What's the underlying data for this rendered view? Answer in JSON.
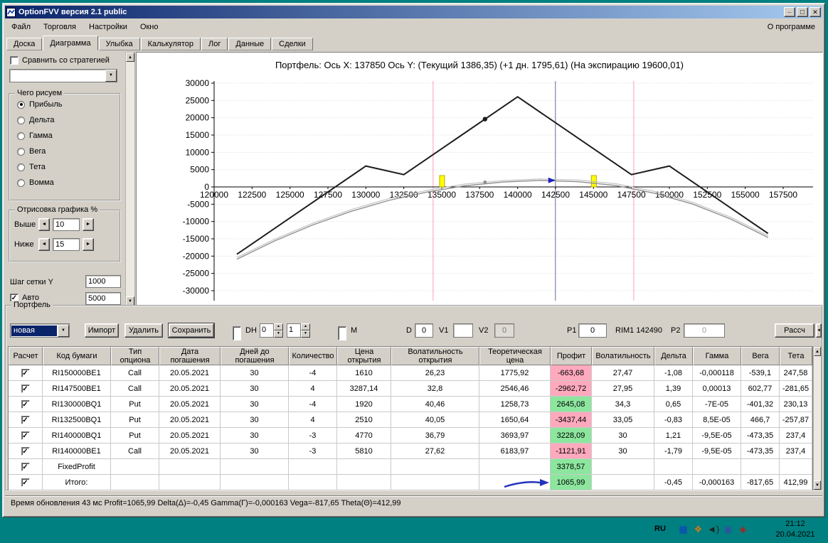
{
  "colors": {
    "desktop": "#008080",
    "window_face": "#d4d0c8",
    "titlebar_left": "#0a246a",
    "titlebar_right": "#a6caf0",
    "profit_positive_bg": "#8ce69e",
    "profit_negative_bg": "#ffa9bd",
    "selection_bg": "#0a246a"
  },
  "window": {
    "title": "OptionFVV версия 2.1 public",
    "menu": [
      "Файл",
      "Торговля",
      "Настройки",
      "Окно"
    ],
    "menu_right": "О программе",
    "tabs": [
      "Доска",
      "Диаграмма",
      "Улыбка",
      "Калькулятор",
      "Лог",
      "Данные",
      "Сделки"
    ],
    "active_tab": "Диаграмма"
  },
  "left_panel": {
    "compare_label": "Сравнить со стратегией",
    "compare_checked": false,
    "strategy_dropdown_value": "",
    "draw_group": {
      "title": "Чего рисуем",
      "options": [
        "Прибыль",
        "Дельта",
        "Гамма",
        "Вега",
        "Тета",
        "Вомма"
      ],
      "selected": "Прибыль"
    },
    "range_group": {
      "title": "Отрисовка графика %",
      "above_label": "Выше",
      "above_value": "10",
      "below_label": "Ниже",
      "below_value": "15"
    },
    "grid_step_label": "Шаг сетки Y",
    "grid_step_value": "1000",
    "auto_label": "Авто",
    "auto_checked": true,
    "auto_value": "5000"
  },
  "chart_data": {
    "type": "line",
    "title": "Портфель: Ось X: 137850 Ось Y:  (Текущий 1386,35)  (+1 дн. 1795,61)  (На экспирацию 19600,01)",
    "xlim": [
      120000,
      157500
    ],
    "ylim": [
      -30000,
      30000
    ],
    "x_ticks": [
      120000,
      122500,
      125000,
      127500,
      130000,
      132500,
      135000,
      137500,
      140000,
      142500,
      145000,
      147500,
      150000,
      152500,
      155000,
      157500
    ],
    "y_ticks": [
      30000,
      25000,
      20000,
      15000,
      10000,
      5000,
      0,
      -5000,
      -10000,
      -15000,
      -20000,
      -25000,
      -30000
    ],
    "grid": true,
    "legend": "none",
    "series": [
      {
        "name": "expiration-payoff",
        "color": "#1c1c1c",
        "width": 2,
        "points": [
          [
            121500,
            -19450
          ],
          [
            130000,
            6050
          ],
          [
            132500,
            3550
          ],
          [
            140000,
            26050
          ],
          [
            147500,
            3550
          ],
          [
            150000,
            6050
          ],
          [
            156500,
            -13450
          ]
        ]
      },
      {
        "name": "current-profit",
        "color": "#8f8f8f",
        "width": 1.4,
        "points": [
          [
            121500,
            -20900
          ],
          [
            124000,
            -15600
          ],
          [
            126500,
            -11000
          ],
          [
            129000,
            -7100
          ],
          [
            131500,
            -3900
          ],
          [
            134000,
            -1500
          ],
          [
            136500,
            300
          ],
          [
            139000,
            1400
          ],
          [
            141500,
            1900
          ],
          [
            144000,
            1500
          ],
          [
            146500,
            400
          ],
          [
            149000,
            -1800
          ],
          [
            151500,
            -4900
          ],
          [
            154000,
            -9200
          ],
          [
            156500,
            -14600
          ]
        ]
      },
      {
        "name": "plus-one-day-profit",
        "color": "#bdbdbd",
        "width": 1.1,
        "points": [
          [
            121500,
            -20400
          ],
          [
            124000,
            -15100
          ],
          [
            126500,
            -10500
          ],
          [
            129000,
            -6600
          ],
          [
            131500,
            -3400
          ],
          [
            134000,
            -1000
          ],
          [
            136500,
            800
          ],
          [
            139000,
            1800
          ],
          [
            141500,
            2300
          ],
          [
            144000,
            2000
          ],
          [
            146500,
            900
          ],
          [
            149000,
            -1300
          ],
          [
            151500,
            -4400
          ],
          [
            154000,
            -8700
          ],
          [
            156500,
            -14100
          ]
        ]
      }
    ],
    "vlines": [
      {
        "x": 134430,
        "color": "#ffb0c4"
      },
      {
        "x": 147650,
        "color": "#ffb0c4"
      },
      {
        "x": 142490,
        "color": "#7a86a8"
      }
    ],
    "markers": {
      "yellow_bars_x": [
        135000,
        145000
      ],
      "dots": [
        {
          "x": 137850,
          "y": 19600,
          "color": "#1c1c1c"
        },
        {
          "x": 137850,
          "y": 1386,
          "color": "#8f8f8f"
        }
      ],
      "blue_pointer": {
        "x": 142490,
        "y": 1900,
        "color": "#2020c0"
      }
    }
  },
  "portfolio": {
    "group_title": "Портфель",
    "preset_value": "новая",
    "import_button": "Импорт",
    "delete_button": "Удалить",
    "save_button": "Сохранить",
    "dh_label": "DH",
    "dh_spin1": "0",
    "dh_spin2": "1",
    "m_label": "M",
    "d_label": "D",
    "d_value": "0",
    "v1_label": "V1",
    "v1_value": "",
    "v2_label": "V2",
    "v2_value": "0",
    "p1_label": "P1",
    "p1_value": "0",
    "rim_label": "RIM1 142490",
    "p2_label": "P2",
    "p2_value": "0",
    "calc_button": "Рассч",
    "table": {
      "columns": [
        "Расчет",
        "Код бумаги",
        "Тип опциона",
        "Дата погашения",
        "Дней до погашения",
        "Количество",
        "Цена открытия",
        "Волатильность открытия",
        "Теоретическая цена",
        "Профит",
        "Волатильность",
        "Дельта",
        "Гамма",
        "Вега",
        "Тета"
      ],
      "rows": [
        {
          "checked": true,
          "code": "RI150000BE1",
          "type": "Call",
          "date": "20.05.2021",
          "days": "30",
          "qty": "-4",
          "open_price": "1610",
          "open_vol": "26,23",
          "theo_price": "1775,92",
          "profit": "-663,68",
          "profit_sign": "neg",
          "volatility": "27,47",
          "delta": "-1,08",
          "gamma": "-0,000118",
          "vega": "-539,1",
          "theta": "247,58"
        },
        {
          "checked": true,
          "code": "RI147500BE1",
          "type": "Call",
          "date": "20.05.2021",
          "days": "30",
          "qty": "4",
          "open_price": "3287,14",
          "open_vol": "32,8",
          "theo_price": "2546,46",
          "profit": "-2962,72",
          "profit_sign": "neg",
          "volatility": "27,95",
          "delta": "1,39",
          "gamma": "0,00013",
          "vega": "602,77",
          "theta": "-281,65"
        },
        {
          "checked": true,
          "code": "RI130000BQ1",
          "type": "Put",
          "date": "20.05.2021",
          "days": "30",
          "qty": "-4",
          "open_price": "1920",
          "open_vol": "40,46",
          "theo_price": "1258,73",
          "profit": "2645,08",
          "profit_sign": "pos",
          "volatility": "34,3",
          "delta": "0,65",
          "gamma": "-7E-05",
          "vega": "-401,32",
          "theta": "230,13"
        },
        {
          "checked": true,
          "code": "RI132500BQ1",
          "type": "Put",
          "date": "20.05.2021",
          "days": "30",
          "qty": "4",
          "open_price": "2510",
          "open_vol": "40,05",
          "theo_price": "1650,64",
          "profit": "-3437,44",
          "profit_sign": "neg",
          "volatility": "33,05",
          "delta": "-0,83",
          "gamma": "8,5E-05",
          "vega": "466,7",
          "theta": "-257,87"
        },
        {
          "checked": true,
          "code": "RI140000BQ1",
          "type": "Put",
          "date": "20.05.2021",
          "days": "30",
          "qty": "-3",
          "open_price": "4770",
          "open_vol": "36,79",
          "theo_price": "3693,97",
          "profit": "3228,09",
          "profit_sign": "pos",
          "volatility": "30",
          "delta": "1,21",
          "gamma": "-9,5E-05",
          "vega": "-473,35",
          "theta": "237,4"
        },
        {
          "checked": true,
          "code": "RI140000BE1",
          "type": "Call",
          "date": "20.05.2021",
          "days": "30",
          "qty": "-3",
          "open_price": "5810",
          "open_vol": "27,62",
          "theo_price": "6183,97",
          "profit": "-1121,91",
          "profit_sign": "neg",
          "volatility": "30",
          "delta": "-1,79",
          "gamma": "-9,5E-05",
          "vega": "-473,35",
          "theta": "237,4"
        },
        {
          "checked": true,
          "code": "FixedProfit",
          "type": "",
          "date": "",
          "days": "",
          "qty": "",
          "open_price": "",
          "open_vol": "",
          "theo_price": "",
          "profit": "3378,57",
          "profit_sign": "pos",
          "volatility": "",
          "delta": "",
          "gamma": "",
          "vega": "",
          "theta": ""
        },
        {
          "checked": true,
          "code": "Итого:",
          "type": "",
          "date": "",
          "days": "",
          "qty": "",
          "open_price": "",
          "open_vol": "",
          "theo_price": "",
          "profit": "1065,99",
          "profit_sign": "pos",
          "volatility": "",
          "delta": "-0,45",
          "gamma": "-0,000163",
          "vega": "-817,65",
          "theta": "412,99"
        }
      ]
    }
  },
  "status_bar": "Время обновления 43 мс  Profit=1065,99 Delta(Δ)=-0,45 Gamma(Г)=-0,000163 Vega=-817,65 Theta(Θ)=412,99",
  "tray": {
    "lang": "RU",
    "time": "21:12",
    "date": "20.04.2021"
  }
}
